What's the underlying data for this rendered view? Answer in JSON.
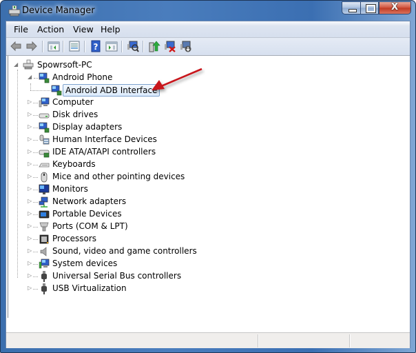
{
  "window": {
    "title": "Device Manager",
    "controls": {
      "minimize": "minimize",
      "maximize": "maximize",
      "close": "X"
    }
  },
  "menu": [
    {
      "label": "File"
    },
    {
      "label": "Action"
    },
    {
      "label": "View"
    },
    {
      "label": "Help"
    }
  ],
  "toolbar": [
    {
      "name": "back",
      "icon": "back-arrow-icon"
    },
    {
      "name": "forward",
      "icon": "forward-arrow-icon"
    },
    {
      "name": "show-hide-console-tree",
      "icon": "console-tree-icon"
    },
    {
      "name": "properties",
      "icon": "properties-icon"
    },
    {
      "name": "help",
      "icon": "help-icon"
    },
    {
      "name": "show-hide-action-pane",
      "icon": "action-pane-icon"
    },
    {
      "name": "scan-for-hardware-changes",
      "icon": "scan-hardware-icon"
    },
    {
      "name": "update-driver-software",
      "icon": "update-driver-icon"
    },
    {
      "name": "uninstall",
      "icon": "uninstall-icon"
    },
    {
      "name": "disable",
      "icon": "disable-device-icon"
    }
  ],
  "tree": {
    "root": {
      "label": "Spowrsoft-PC",
      "expanded": true,
      "icon": "computer-pc-icon"
    },
    "expanded_category": {
      "label": "Android Phone",
      "icon": "android-phone-icon",
      "expanded": true,
      "children": [
        {
          "label": "Android ADB Interface",
          "icon": "adb-interface-icon",
          "selected": true
        }
      ]
    },
    "categories": [
      {
        "label": "Computer",
        "icon": "computer-icon"
      },
      {
        "label": "Disk drives",
        "icon": "disk-drive-icon"
      },
      {
        "label": "Display adapters",
        "icon": "display-adapter-icon"
      },
      {
        "label": "Human Interface Devices",
        "icon": "hid-icon"
      },
      {
        "label": "IDE ATA/ATAPI controllers",
        "icon": "ide-controller-icon"
      },
      {
        "label": "Keyboards",
        "icon": "keyboard-icon"
      },
      {
        "label": "Mice and other pointing devices",
        "icon": "mouse-icon"
      },
      {
        "label": "Monitors",
        "icon": "monitor-icon"
      },
      {
        "label": "Network adapters",
        "icon": "network-adapter-icon"
      },
      {
        "label": "Portable Devices",
        "icon": "portable-device-icon"
      },
      {
        "label": "Ports (COM & LPT)",
        "icon": "port-icon"
      },
      {
        "label": "Processors",
        "icon": "processor-icon"
      },
      {
        "label": "Sound, video and game controllers",
        "icon": "speaker-icon"
      },
      {
        "label": "System devices",
        "icon": "system-device-icon"
      },
      {
        "label": "Universal Serial Bus controllers",
        "icon": "usb-icon"
      },
      {
        "label": "USB Virtualization",
        "icon": "usb-icon"
      }
    ]
  },
  "annotation": {
    "type": "arrow",
    "points_to": "Android ADB Interface",
    "color": "#c8161d"
  },
  "statusbar": {
    "sections": [
      "",
      "",
      ""
    ]
  }
}
